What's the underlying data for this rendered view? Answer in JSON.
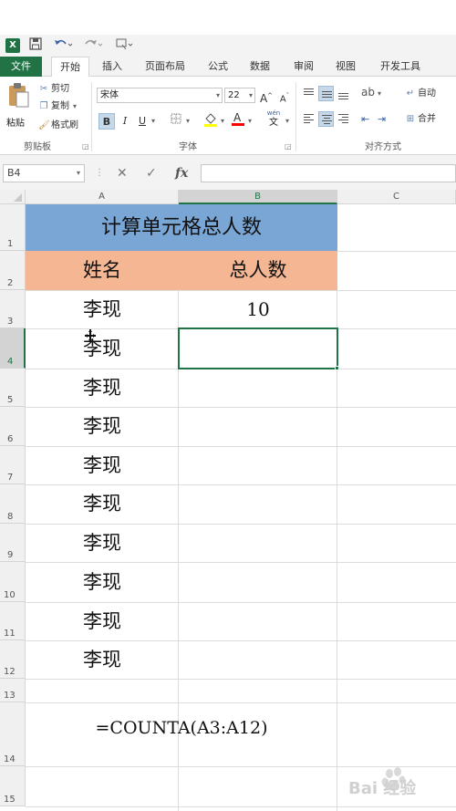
{
  "qat": {
    "excel_badge": "X",
    "save_icon": "save-icon",
    "undo_icon": "undo-icon",
    "redo_icon": "redo-icon"
  },
  "tabs": [
    {
      "label": "文件"
    },
    {
      "label": "开始"
    },
    {
      "label": "插入"
    },
    {
      "label": "页面布局"
    },
    {
      "label": "公式"
    },
    {
      "label": "数据"
    },
    {
      "label": "审阅"
    },
    {
      "label": "视图"
    },
    {
      "label": "开发工具"
    }
  ],
  "ribbon": {
    "clipboard": {
      "paste": "粘贴",
      "cut": "剪切",
      "copy": "复制",
      "format_painter": "格式刷",
      "group": "剪贴板"
    },
    "font": {
      "name": "宋体",
      "size": "22",
      "bold": "B",
      "italic": "I",
      "underline": "U",
      "group": "字体",
      "phonetic_top": "wén",
      "phonetic_bottom": "文"
    },
    "alignment": {
      "wrap": "自动",
      "merge": "合并",
      "group": "对齐方式"
    },
    "colors": {
      "fill": "#ffff00",
      "font": "#ff0000",
      "accent": "#217346"
    }
  },
  "formula_bar": {
    "name_box": "B4",
    "cancel": "✕",
    "enter": "✓",
    "fx": "fx",
    "value": ""
  },
  "columns": [
    "A",
    "B",
    "C"
  ],
  "rows": [
    "1",
    "2",
    "3",
    "4",
    "5",
    "6",
    "7",
    "8",
    "9",
    "10",
    "11",
    "12",
    "13",
    "14",
    "15"
  ],
  "sheet": {
    "title": "计算单元格总人数",
    "header_a": "姓名",
    "header_b": "总人数",
    "names": [
      "李现",
      "李现",
      "李现",
      "李现",
      "李现",
      "李现",
      "李现",
      "李现",
      "李现",
      "李现"
    ],
    "count": "10",
    "formula_note": "=COUNTA(A3:A12)",
    "colors": {
      "title_bg": "#7aa6d6",
      "header_bg": "#f4b693"
    }
  },
  "watermark": {
    "text": "Bai 经验"
  }
}
